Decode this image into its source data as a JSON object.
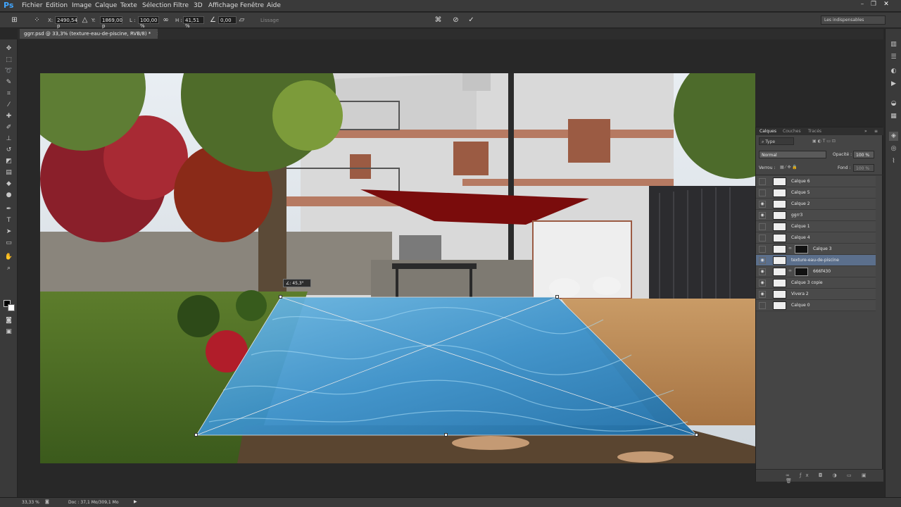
{
  "app": {
    "logo": "Ps"
  },
  "menu": [
    "Fichier",
    "Edition",
    "Image",
    "Calque",
    "Texte",
    "Sélection",
    "Filtre",
    "3D",
    "Affichage",
    "Fenêtre",
    "Aide"
  ],
  "options": {
    "x_label": "X:",
    "x_value": "2490,54 p",
    "y_label": "Y:",
    "y_value": "1869,00 p",
    "w_label": "L :",
    "w_value": "100,00 %",
    "h_label": "H :",
    "h_value": "41,51 %",
    "angle_value": "0,00",
    "smoothing": "Lissage",
    "workspace": "Les indispensables"
  },
  "document": {
    "tab_title": "ggrr.psd @ 33,3% (texture-eau-de-piscine, RVB/8) *"
  },
  "transform_tip": "∠: 45,3°",
  "layers_panel": {
    "tabs": [
      "Calques",
      "Couches",
      "Tracés"
    ],
    "filter": "Type",
    "blend_mode": "Normal",
    "opacity_label": "Opacité :",
    "opacity_value": "100 %",
    "lock_label": "Verrou :",
    "fill_label": "Fond :",
    "fill_value": "100 %",
    "layers": [
      {
        "name": "Calque 6",
        "visible": false,
        "mask": false
      },
      {
        "name": "Calque 5",
        "visible": false,
        "mask": false
      },
      {
        "name": "Calque 2",
        "visible": true,
        "mask": false
      },
      {
        "name": "ggrr3",
        "visible": true,
        "mask": false
      },
      {
        "name": "Calque 1",
        "visible": false,
        "mask": false
      },
      {
        "name": "Calque 4",
        "visible": false,
        "mask": false
      },
      {
        "name": "Calque 3",
        "visible": false,
        "mask": true
      },
      {
        "name": "texture-eau-de-piscine",
        "visible": true,
        "mask": false,
        "selected": true
      },
      {
        "name": "666f430",
        "visible": true,
        "mask": true
      },
      {
        "name": "Calque 3 copie",
        "visible": true,
        "mask": false
      },
      {
        "name": "Vivera 2",
        "visible": true,
        "mask": false
      },
      {
        "name": "Calque 0",
        "visible": false,
        "mask": false
      }
    ]
  },
  "status": {
    "zoom": "33,33 %",
    "doc": "Doc : 37,1 Mo/309,1 Mo"
  }
}
